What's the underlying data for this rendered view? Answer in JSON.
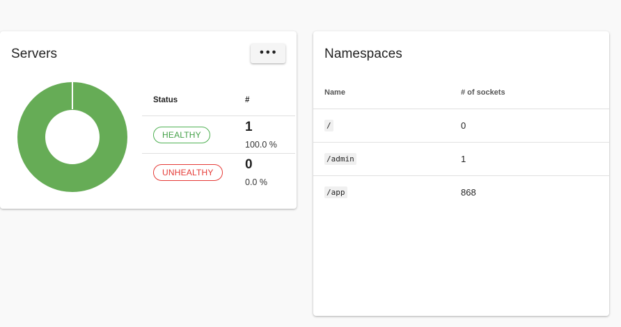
{
  "servers": {
    "title": "Servers",
    "more_label": "•••",
    "donut": {
      "healthy_fraction": 1.0,
      "healthy_color": "#66ac56",
      "unhealthy_color": "#e53935"
    },
    "table": {
      "headers": {
        "status": "Status",
        "count": "#"
      },
      "rows": [
        {
          "status": "HEALTHY",
          "count": "1",
          "percent": "100.0 %"
        },
        {
          "status": "UNHEALTHY",
          "count": "0",
          "percent": "0.0 %"
        }
      ]
    }
  },
  "namespaces": {
    "title": "Namespaces",
    "headers": {
      "name": "Name",
      "sockets": "# of sockets"
    },
    "rows": [
      {
        "name": "/",
        "sockets": "0"
      },
      {
        "name": "/admin",
        "sockets": "1"
      },
      {
        "name": "/app",
        "sockets": "868"
      }
    ]
  }
}
